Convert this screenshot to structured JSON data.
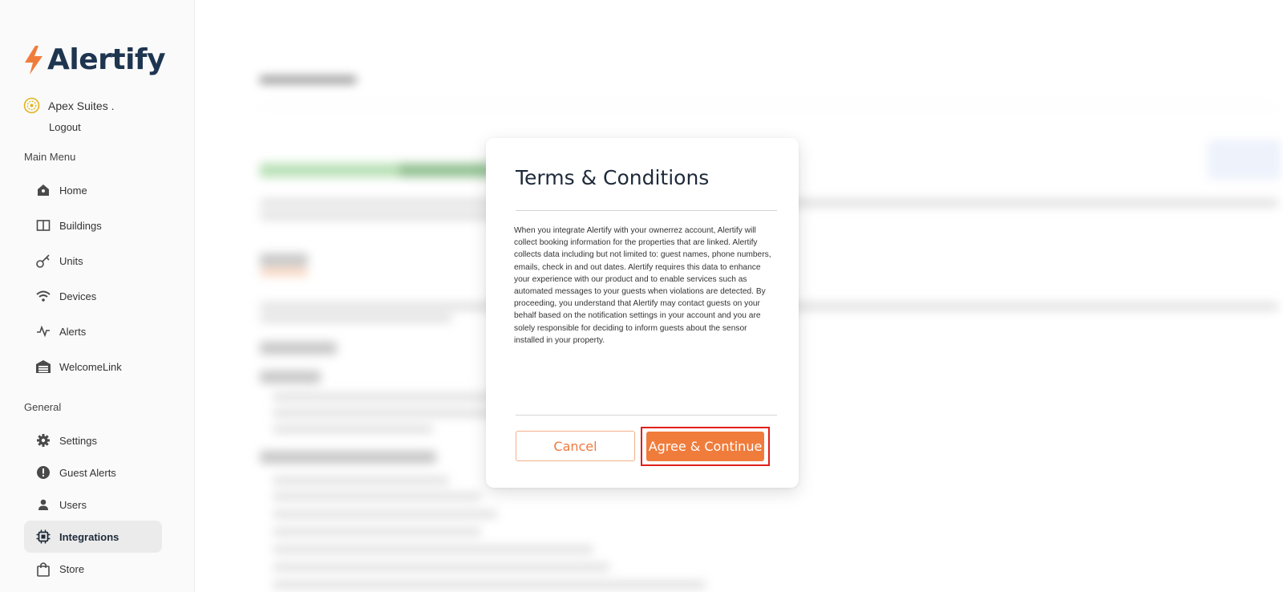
{
  "brand": {
    "name": "Alertify",
    "accent": "#f07c3c",
    "text_color": "#1e3550"
  },
  "account": {
    "name": "Apex Suites .",
    "logout_label": "Logout"
  },
  "sidebar": {
    "main_menu_title": "Main Menu",
    "main_items": [
      {
        "label": "Home",
        "icon": "home-icon"
      },
      {
        "label": "Buildings",
        "icon": "book-icon"
      },
      {
        "label": "Units",
        "icon": "key-icon"
      },
      {
        "label": "Devices",
        "icon": "wifi-icon"
      },
      {
        "label": "Alerts",
        "icon": "pulse-icon"
      },
      {
        "label": "WelcomeLink",
        "icon": "garage-icon"
      }
    ],
    "general_title": "General",
    "general_items": [
      {
        "label": "Settings",
        "icon": "gear-icon"
      },
      {
        "label": "Guest Alerts",
        "icon": "exclamation-icon"
      },
      {
        "label": "Users",
        "icon": "user-icon"
      },
      {
        "label": "Integrations",
        "icon": "chip-icon",
        "active": true
      },
      {
        "label": "Store",
        "icon": "bag-icon"
      }
    ]
  },
  "modal": {
    "title": "Terms & Conditions",
    "body": "When you integrate Alertify with your ownerrez account, Alertify will collect booking information for the properties that are linked. Alertify collects data including but not limited to: guest names, phone numbers, emails, check in and out dates. Alertify requires this data to enhance your experience with our product and to enable services such as automated messages to your guests when violations are detected. By proceeding, you understand that Alertify may contact guests on your behalf based on the notification settings in your account and you are solely responsible for deciding to inform guests about the sensor installed in your property.",
    "cancel_label": "Cancel",
    "agree_label": "Agree & Continue"
  }
}
